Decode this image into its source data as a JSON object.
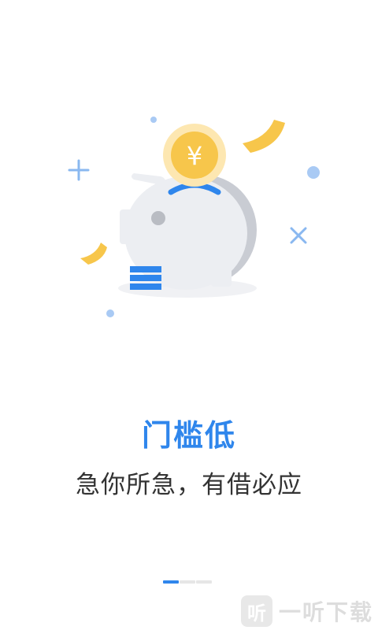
{
  "intro": {
    "title": "门槛低",
    "subtitle": "急你所急，有借必应",
    "coin_symbol": "¥",
    "page_indicator": {
      "total": 3,
      "active": 1
    }
  },
  "watermark": {
    "logo_glyph": "听",
    "text": "一听下载"
  },
  "colors": {
    "accent": "#2f86ec",
    "coin": "#f7c64b",
    "pig": "#eceef2",
    "text": "#333333"
  },
  "icons": [
    "piggy-bank-icon",
    "coin-icon",
    "plus-icon",
    "cross-icon"
  ]
}
